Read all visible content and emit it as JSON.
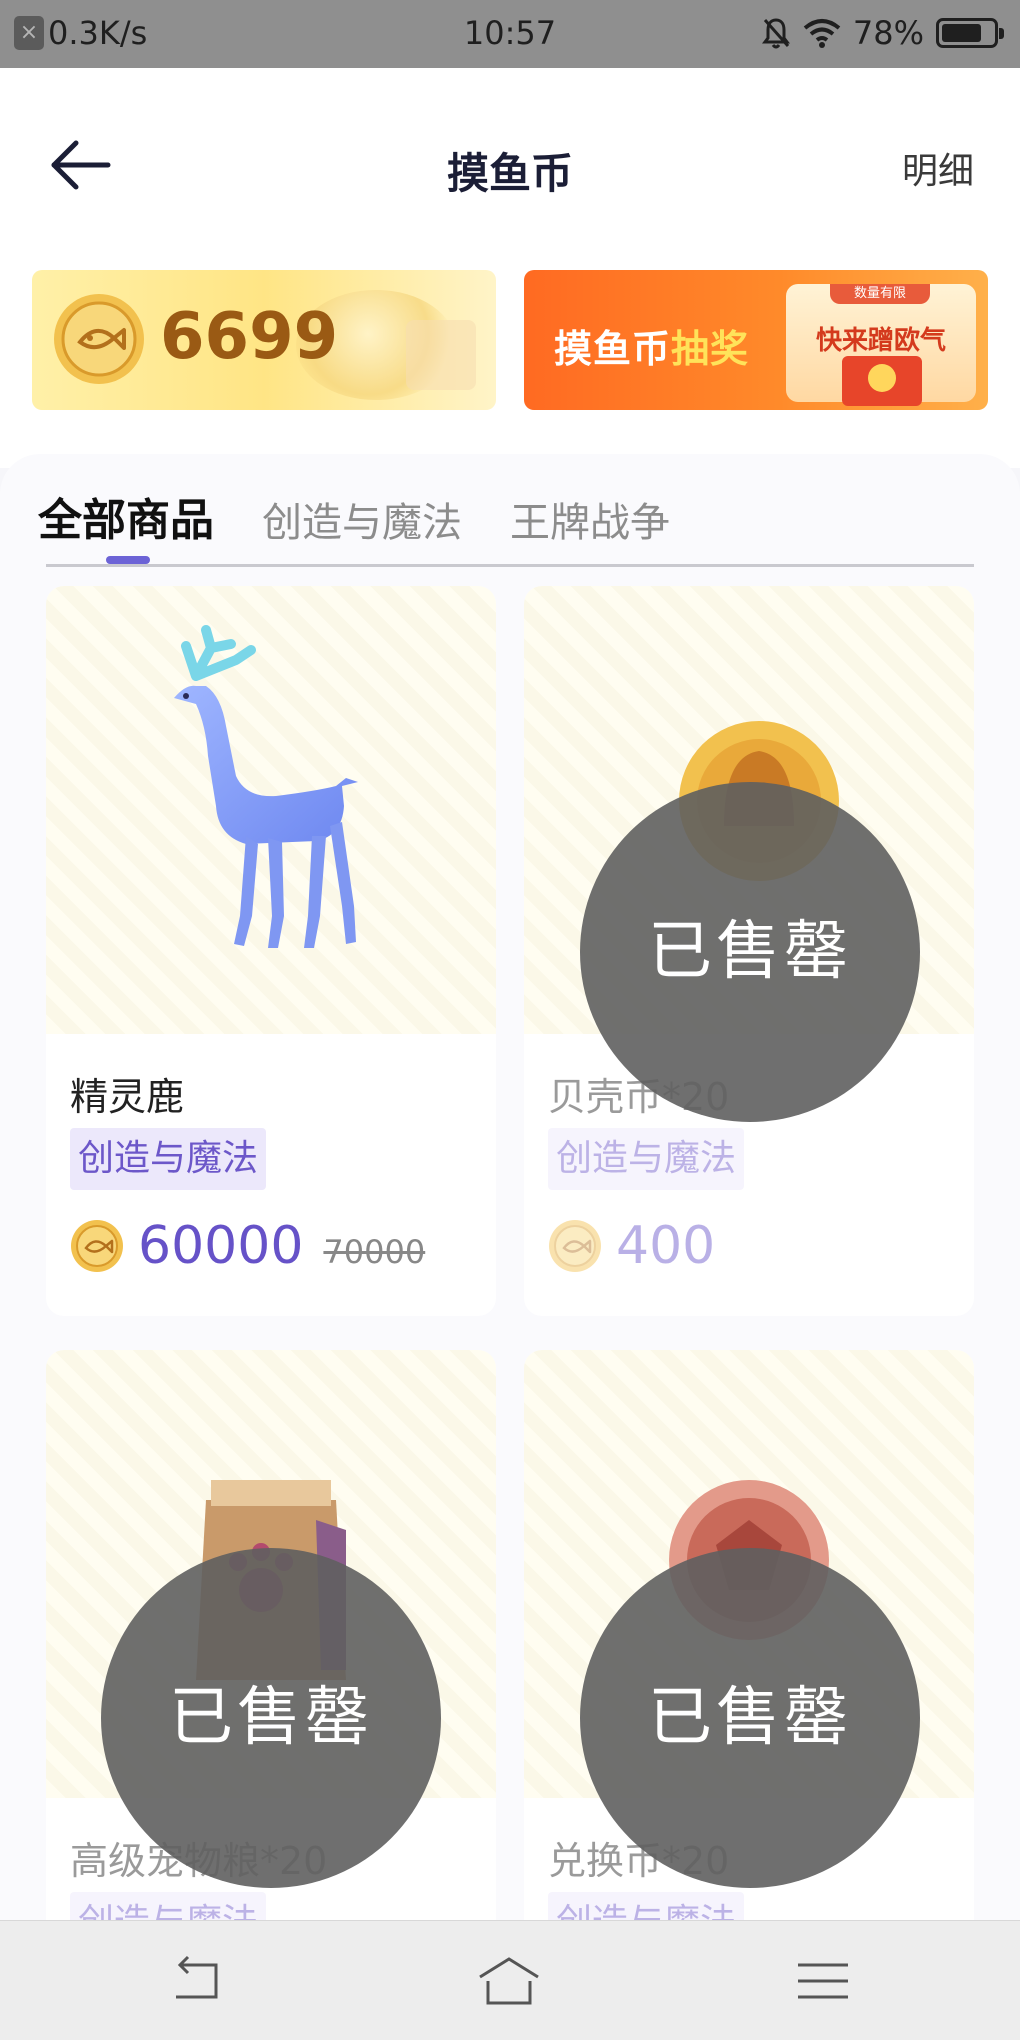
{
  "status_bar": {
    "network_speed": "0.3K/s",
    "time": "10:57",
    "battery": "78%",
    "icons": [
      "mute-icon",
      "wifi-icon",
      "battery-icon"
    ]
  },
  "header": {
    "title": "摸鱼币",
    "detail_link": "明细",
    "back_icon": "back-arrow-icon"
  },
  "banners": {
    "coin_balance": "6699",
    "lottery_text_white": "摸鱼币",
    "lottery_text_highlight": "抽奖",
    "lottery_tag": "数量有限",
    "lottery_cta": "快来蹭欧气"
  },
  "tabs": [
    {
      "label": "全部商品",
      "active": true
    },
    {
      "label": "创造与魔法",
      "active": false
    },
    {
      "label": "王牌战争",
      "active": false
    }
  ],
  "products": [
    {
      "name": "精灵鹿",
      "category": "创造与魔法",
      "price": "60000",
      "original_price": "70000",
      "sold_out": false
    },
    {
      "name": "贝壳币*20",
      "category": "创造与魔法",
      "price": "400",
      "sold_out": true,
      "sold_out_label": "已售罄"
    },
    {
      "name": "高级宠物粮*20",
      "category": "创造与魔法",
      "sold_out": true,
      "sold_out_label": "已售罄"
    },
    {
      "name": "兑换币*20",
      "category": "创造与魔法",
      "sold_out": true,
      "sold_out_label": "已售罄"
    }
  ],
  "colors": {
    "accent": "#6652c8",
    "coin_gold": "#f2c14e",
    "lottery_orange": "#ff6a22"
  },
  "nav_bar": [
    "back-nav-icon",
    "home-nav-icon",
    "menu-nav-icon"
  ]
}
